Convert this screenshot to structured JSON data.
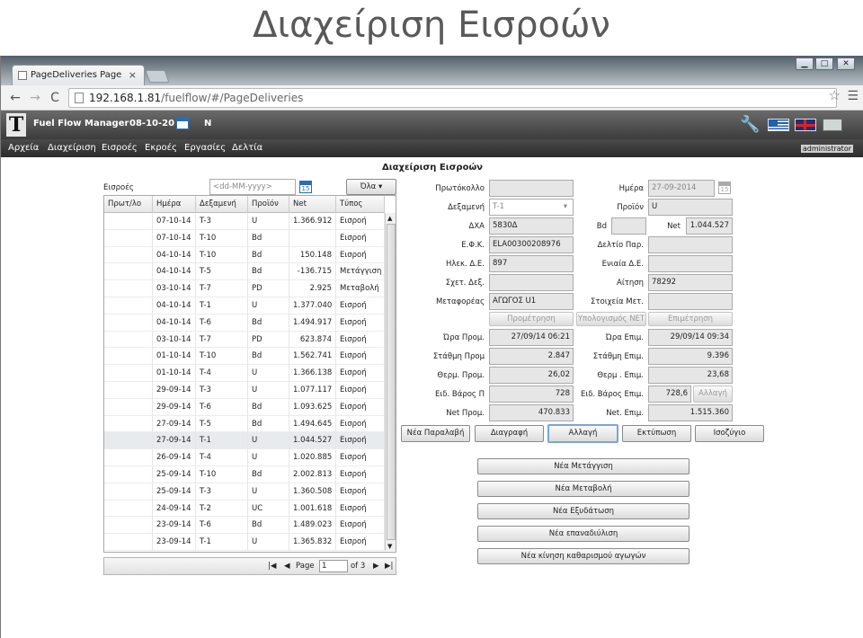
{
  "slide": {
    "title": "Διαχείριση Εισροών"
  },
  "browser": {
    "tab_title": "PageDeliveries Page",
    "tab_close": "×",
    "url_host": "192.168.1.81",
    "url_path": "/fuelflow/#/PageDeliveries",
    "back": "←",
    "forward": "→",
    "reload": "C",
    "star": "☆",
    "menu": "☰",
    "minimize": "▁",
    "maximize": "□",
    "close": "✕"
  },
  "app": {
    "name": "Fuel Flow Manager",
    "date": "08-10-20",
    "n_label": "N",
    "user": "administrator",
    "logo_letter": "T",
    "wrench": "🔧"
  },
  "menu": [
    "Αρχεία",
    "Διαχείριση",
    "Εισροές",
    "Εκροές",
    "Εργασίες",
    "Δελτία"
  ],
  "page": {
    "title": "Διαχείριση Εισροών",
    "filter_label": "Εισροές",
    "date_placeholder": "<dd-MM-yyyy>",
    "filter_select": "Όλα",
    "filter_arrow": "▾",
    "cal_day": "15"
  },
  "grid": {
    "columns": [
      "Πρωτ/λο",
      "Ημέρα",
      "Δεξαμενή",
      "Προϊόν",
      "Net",
      "Τύπος"
    ],
    "rows": [
      [
        "",
        "07-10-14",
        "T-3",
        "U",
        "1.366.912",
        "Εισροή"
      ],
      [
        "",
        "07-10-14",
        "T-10",
        "Bd",
        "",
        "Εισροή"
      ],
      [
        "",
        "04-10-14",
        "T-10",
        "Bd",
        "150.148",
        "Εισροή"
      ],
      [
        "",
        "04-10-14",
        "T-5",
        "Bd",
        "-136.715",
        "Μετάγγιση"
      ],
      [
        "",
        "03-10-14",
        "T-7",
        "PD",
        "2.925",
        "Μεταβολή"
      ],
      [
        "",
        "04-10-14",
        "T-1",
        "U",
        "1.377.040",
        "Εισροή"
      ],
      [
        "",
        "04-10-14",
        "T-6",
        "Bd",
        "1.494.917",
        "Εισροή"
      ],
      [
        "",
        "03-10-14",
        "T-7",
        "PD",
        "623.874",
        "Εισροή"
      ],
      [
        "",
        "01-10-14",
        "T-10",
        "Bd",
        "1.562.741",
        "Εισροή"
      ],
      [
        "",
        "01-10-14",
        "T-4",
        "U",
        "1.366.138",
        "Εισροή"
      ],
      [
        "",
        "29-09-14",
        "T-3",
        "U",
        "1.077.117",
        "Εισροή"
      ],
      [
        "",
        "29-09-14",
        "T-6",
        "Bd",
        "1.093.625",
        "Εισροή"
      ],
      [
        "",
        "27-09-14",
        "T-5",
        "Bd",
        "1.494.645",
        "Εισροή"
      ],
      [
        "",
        "27-09-14",
        "T-1",
        "U",
        "1.044.527",
        "Εισροή"
      ],
      [
        "",
        "26-09-14",
        "T-4",
        "U",
        "1.020.885",
        "Εισροή"
      ],
      [
        "",
        "25-09-14",
        "T-10",
        "Bd",
        "2.002.813",
        "Εισροή"
      ],
      [
        "",
        "25-09-14",
        "T-3",
        "U",
        "1.360.508",
        "Εισροή"
      ],
      [
        "",
        "24-09-14",
        "T-2",
        "UC",
        "1.001.618",
        "Εισροή"
      ],
      [
        "",
        "23-09-14",
        "T-6",
        "Bd",
        "1.489.023",
        "Εισροή"
      ],
      [
        "",
        "23-09-14",
        "T-1",
        "U",
        "1.365.832",
        "Εισροή"
      ]
    ],
    "selected_row": 13,
    "scroll_up": "▲",
    "scroll_down": "▼"
  },
  "pager": {
    "first": "|◀",
    "prev": "◀",
    "page_label": "Page",
    "page_value": "1",
    "of_label": "of 3",
    "next": "▶",
    "last": "▶|"
  },
  "form": {
    "protokollo_label": "Πρωτόκολλο",
    "protokollo": "",
    "imera_label": "Ημέρα",
    "imera": "27-09-2014",
    "dexameni_label": "Δεξαμενή",
    "dexameni": "T-1",
    "dexameni_arrow": "▾",
    "proion_label": "Προϊόν",
    "proion": "U",
    "dxa_label": "ΔΧΑ",
    "dxa": "5830Δ",
    "bd_label": "Bd",
    "bd": "",
    "net_label": "Net",
    "net": "1.044.527",
    "efk_label": "Ε.Φ.Κ.",
    "efk": "ELA00300208976",
    "deltio_par_label": "Δελτίο Παρ.",
    "deltio_par": "",
    "ilek_label": "Ηλεκ. Δ.Ε.",
    "ilek": "897",
    "eniaia_label": "Ενιαία Δ.Ε.",
    "eniaia": "",
    "sxet_label": "Σχετ. Δεξ.",
    "sxet": "",
    "aitisi_label": "Αίτηση",
    "aitisi": "78292",
    "metafores_label": "Μεταφορέας",
    "metafores": "ΑΓΩΓΟΣ U1",
    "stoixeia_label": "Στοιχεία Μετ.",
    "stoixeia": "",
    "btn_prometrisi": "Προμέτρηση",
    "btn_ypologismos": "Υπολογισμός ΝΕΤ",
    "btn_epimetrisi": "Επιμέτρηση",
    "ora_prom_label": "Ώρα Προμ.",
    "ora_prom": "27/09/14 06:21",
    "ora_epim_label": "Ώρα Επιμ.",
    "ora_epim": "29/09/14 09:34",
    "stathmi_prom_label": "Στάθμη Προμ",
    "stathmi_prom": "2.847",
    "stathmi_epim_label": "Στάθμη Επιμ.",
    "stathmi_epim": "9.396",
    "therm_prom_label": "Θερμ. Προμ.",
    "therm_prom": "26,02",
    "therm_epim_label": "Θερμ . Επιμ.",
    "therm_epim": "23,68",
    "eid_prom_label": "Ειδ. Βάρος Π",
    "eid_prom": "728",
    "eid_epim_label": "Ειδ. Βάρος Επιμ.",
    "eid_epim": "728,6",
    "btn_allagi_small": "Αλλαγή",
    "net_prom_label": "Net Προμ.",
    "net_prom": "470.833",
    "net_epim_label": "Net. Επιμ.",
    "net_epim": "1.515.360"
  },
  "actions": {
    "nea_paralavi": "Νέα Παραλαβή",
    "diagrafi": "Διαγραφή",
    "allagi": "Αλλαγή",
    "ektyposi": "Εκτύπωση",
    "isozygio": "Ισοζύγιο",
    "nea_metaggisi": "Νέα Μετάγγιση",
    "nea_metavoli": "Νέα Μεταβολή",
    "nea_exydatosi": "Νέα Εξυδάτωση",
    "nea_epanadiylisi": "Νέα επαναδιύλιση",
    "nea_kinisi": "Νέα κίνηση καθαρισμού αγωγών"
  }
}
